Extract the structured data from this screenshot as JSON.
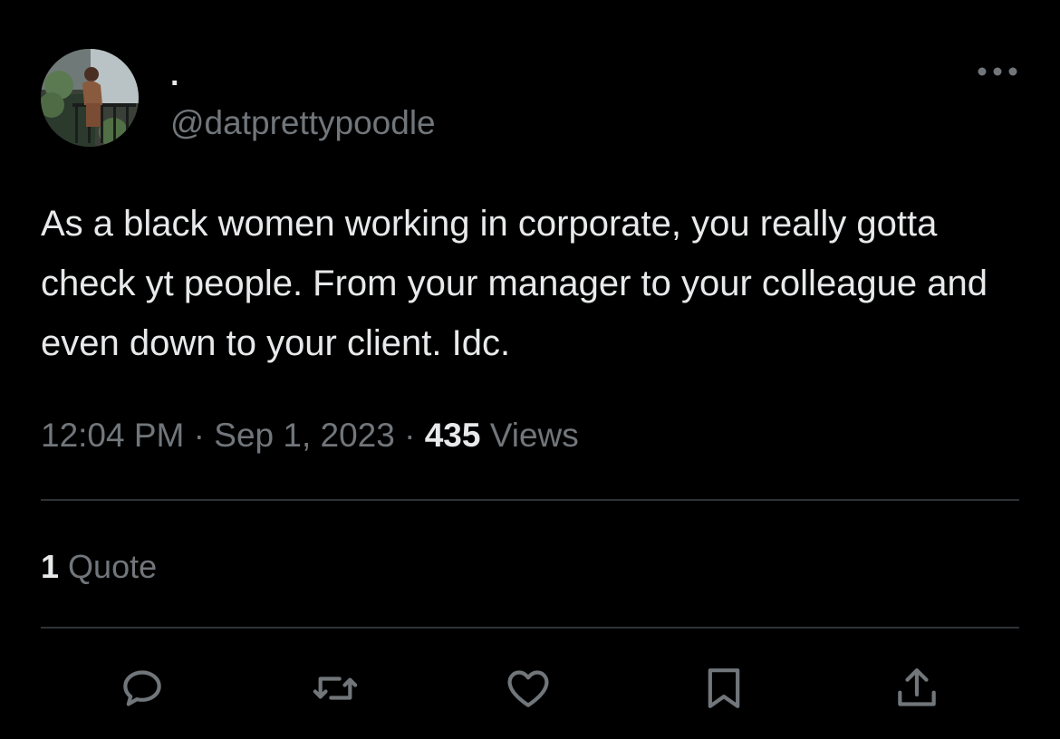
{
  "tweet": {
    "display_name": "·",
    "handle": "@datprettypoodle",
    "text": "As a black women working in corporate, you really gotta check yt people. From your manager to your colleague and even down to your client. Idc.",
    "time": "12:04 PM",
    "separator": "·",
    "date": "Sep 1, 2023",
    "views_count": "435",
    "views_label": "Views"
  },
  "stats": {
    "quotes_count": "1",
    "quotes_label": "Quote"
  },
  "icons": {
    "more": "more-horizontal-icon",
    "reply": "reply-icon",
    "retweet": "retweet-icon",
    "like": "heart-icon",
    "bookmark": "bookmark-icon",
    "share": "share-icon"
  },
  "colors": {
    "background": "#000000",
    "primary_text": "#e7e9ea",
    "secondary_text": "#71767b",
    "divider": "#2f3336"
  }
}
